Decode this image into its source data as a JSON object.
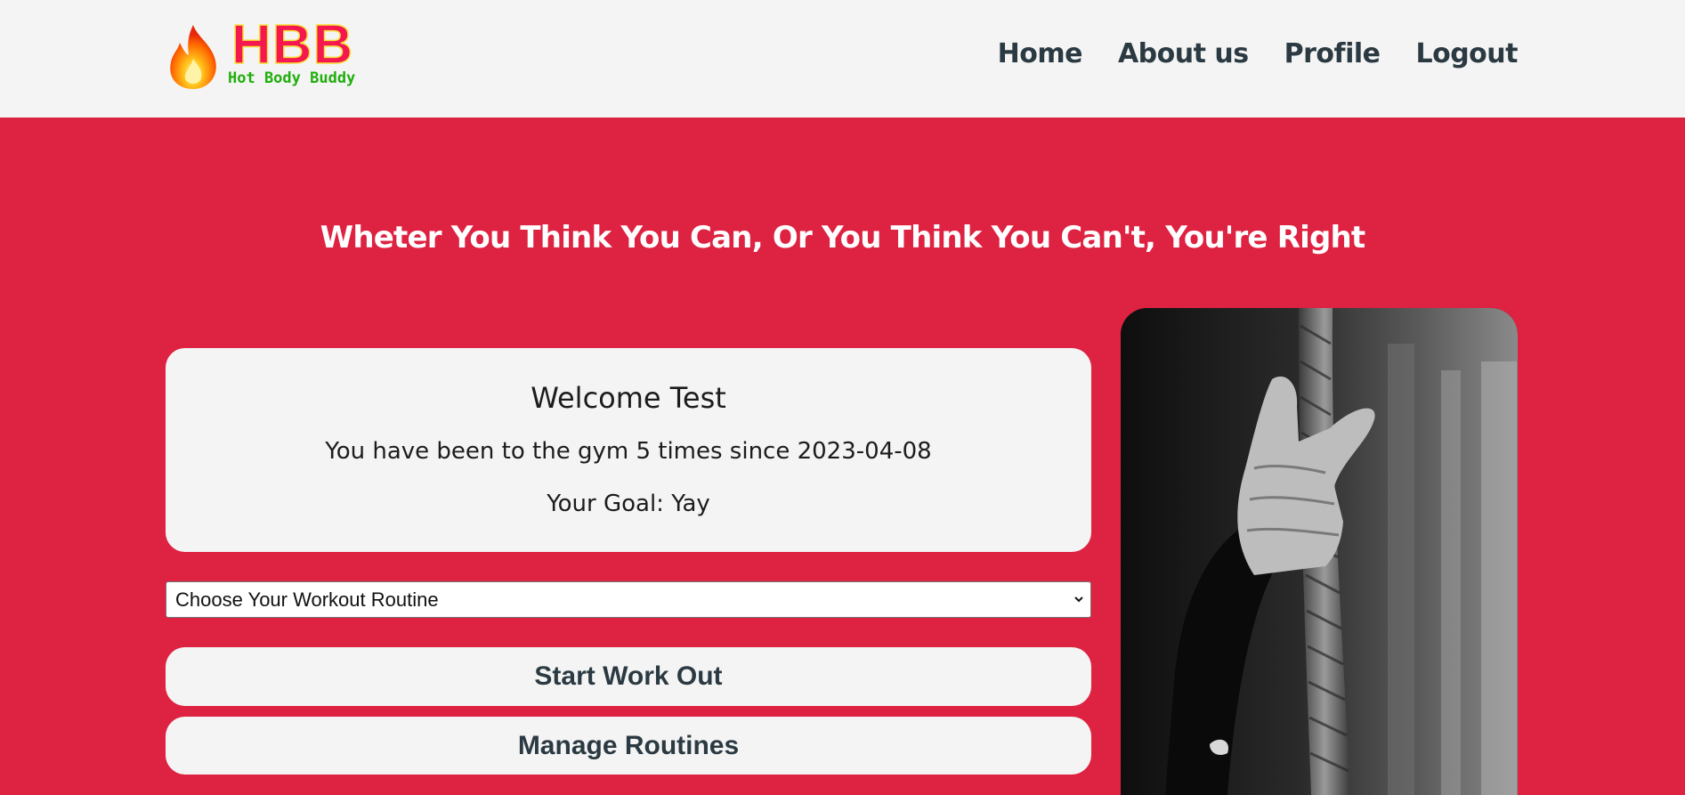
{
  "header": {
    "logo_title": "HBB",
    "logo_subtitle": "Hot Body Buddy",
    "logo_icon": "fire-icon",
    "nav": [
      {
        "label": "Home"
      },
      {
        "label": "About us"
      },
      {
        "label": "Profile"
      },
      {
        "label": "Logout"
      }
    ]
  },
  "main": {
    "headline": "Wheter You Think You Can, Or You Think You Can't, You're Right",
    "welcome": {
      "title": "Welcome Test",
      "visits": "You have been to the gym 5 times since 2023-04-08",
      "goal": "Your Goal: Yay"
    },
    "routine_select": {
      "selected": "Choose Your Workout Routine"
    },
    "start_button": "Start Work Out",
    "manage_button": "Manage Routines",
    "photo": "rope-climb-photo"
  },
  "colors": {
    "background": "#de2241",
    "card": "#f4f4f4",
    "nav_text": "#2b3a42",
    "logo_red": "#f5174f",
    "logo_green": "#1fae0c"
  }
}
